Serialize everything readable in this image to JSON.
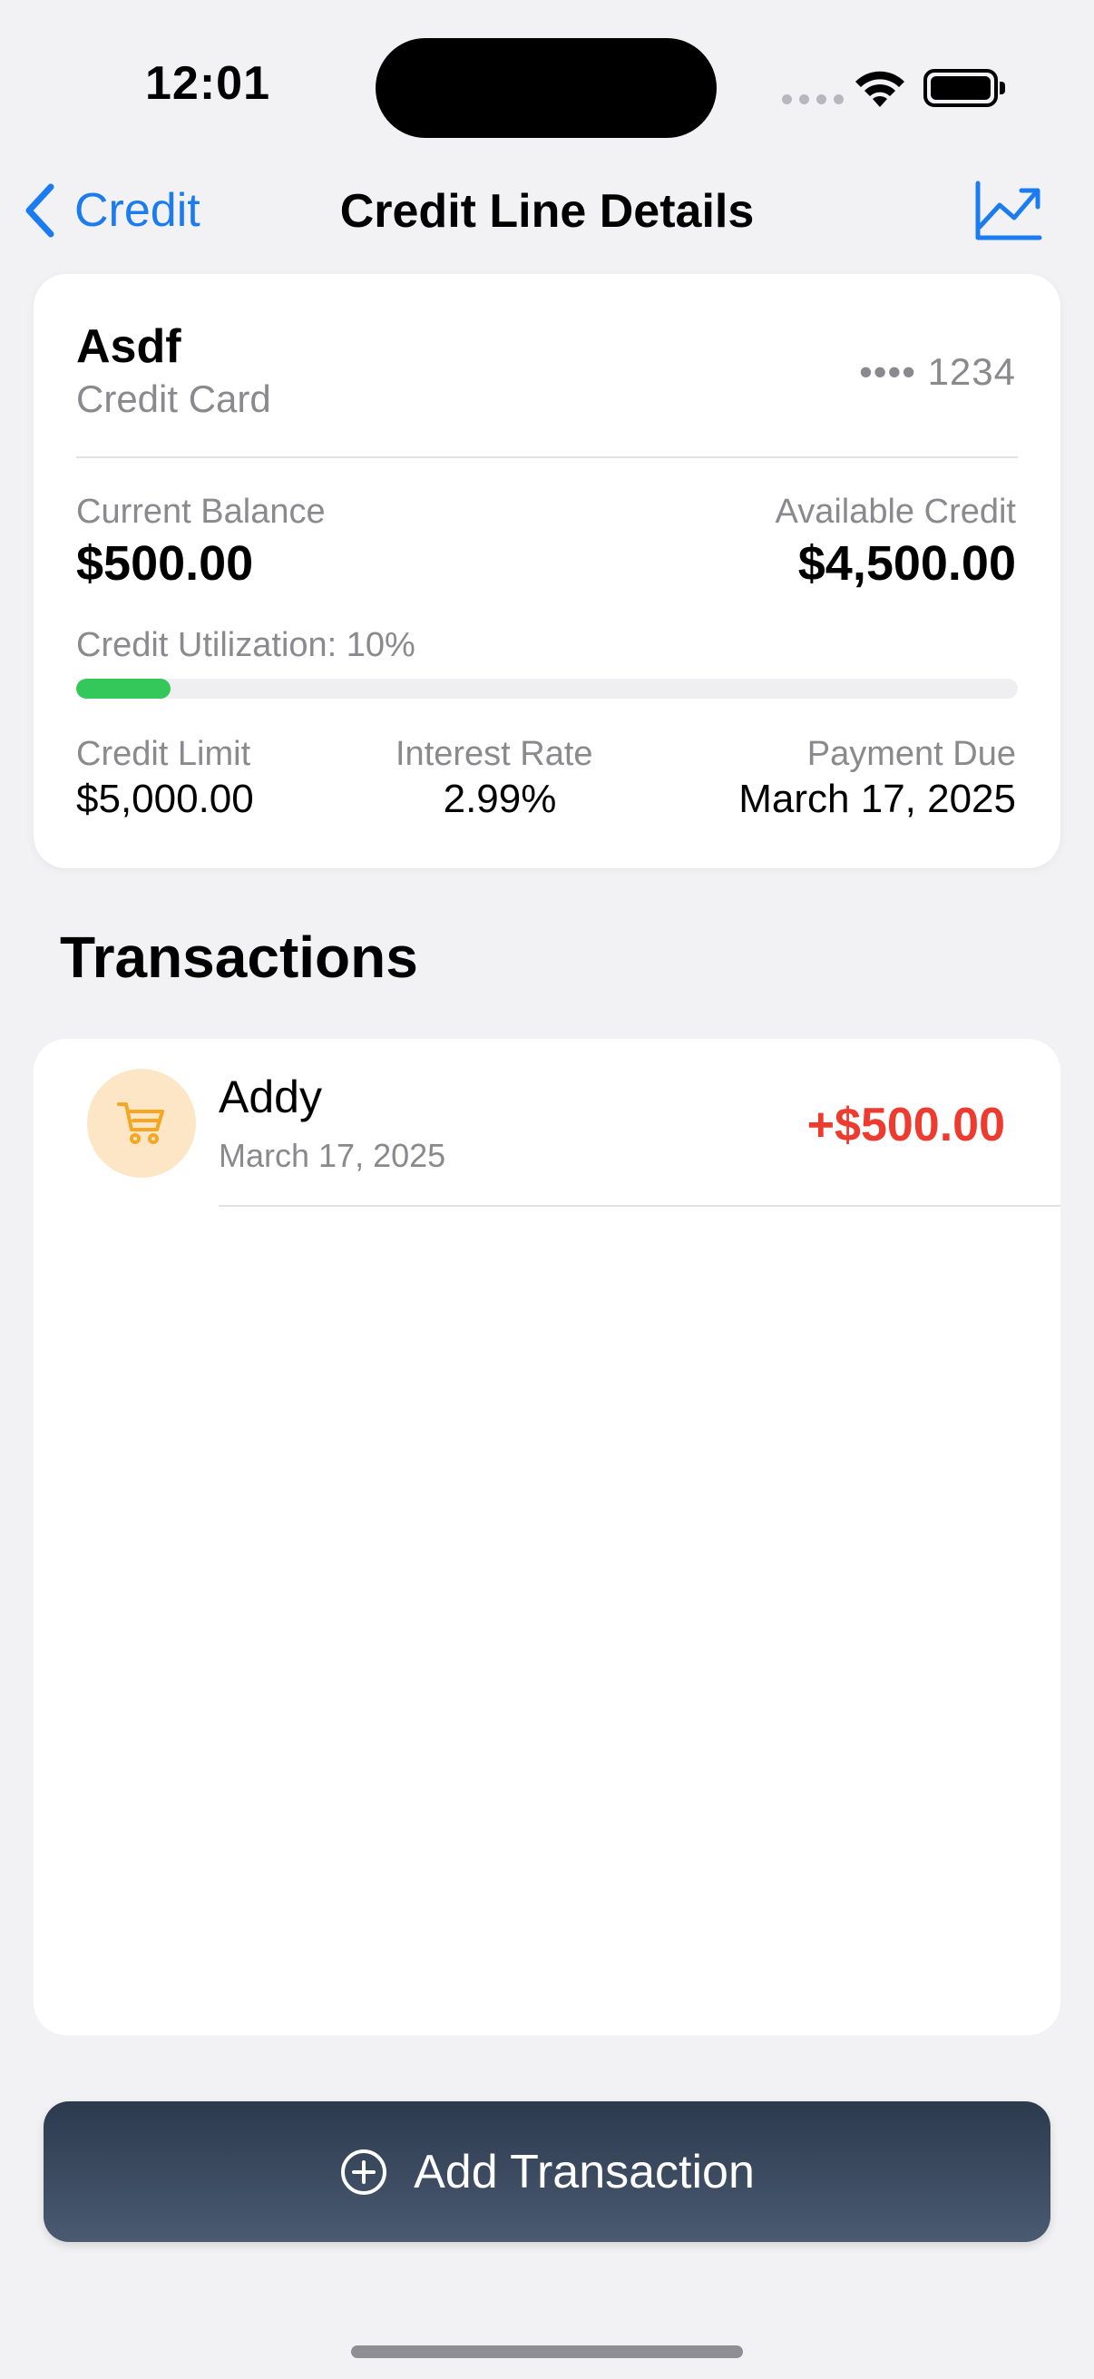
{
  "status_bar": {
    "time": "12:01"
  },
  "nav": {
    "back_label": "Credit",
    "title": "Credit Line Details",
    "chart_icon": "chart-line-uptrend-icon"
  },
  "account": {
    "name": "Asdf",
    "type": "Credit Card",
    "number_masked": "•••• 1234",
    "current_balance_label": "Current Balance",
    "current_balance": "$500.00",
    "available_credit_label": "Available Credit",
    "available_credit": "$4,500.00",
    "utilization_label": "Credit Utilization: 10%",
    "utilization_fraction": 0.1,
    "utilization_color": "#34c759",
    "credit_limit_label": "Credit Limit",
    "credit_limit": "$5,000.00",
    "interest_rate_label": "Interest Rate",
    "interest_rate": "2.99%",
    "payment_due_label": "Payment Due",
    "payment_due": "March 17, 2025"
  },
  "transactions": {
    "heading": "Transactions",
    "items": [
      {
        "name": "Addy",
        "date": "March 17, 2025",
        "amount": "+$500.00",
        "icon": "cart-icon",
        "amount_color": "#ee3b30"
      }
    ]
  },
  "actions": {
    "add_transaction_label": "Add Transaction"
  },
  "colors": {
    "accent": "#1a7cf0",
    "background": "#f2f2f4"
  }
}
